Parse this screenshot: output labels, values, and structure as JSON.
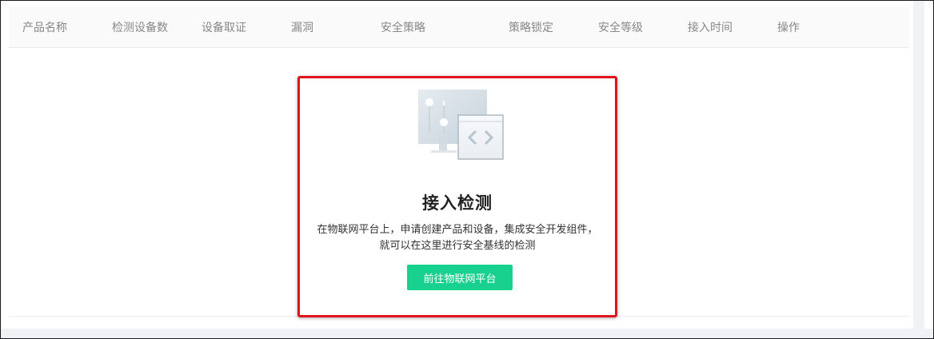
{
  "table": {
    "columns": [
      "产品名称",
      "检测设备数",
      "设备取证",
      "漏洞",
      "安全策略",
      "策略锁定",
      "安全等级",
      "接入时间",
      "操作"
    ]
  },
  "empty_state": {
    "illustration_icon": "monitor-code-window-icon",
    "title": "接入检测",
    "description_line1": "在物联网平台上，申请创建产品和设备，集成安全开发组件，",
    "description_line2": "就可以在这里进行安全基线的检测",
    "button_label": "前往物联网平台",
    "button_color": "#19d18f",
    "highlight_border_color": "#e0141e"
  }
}
